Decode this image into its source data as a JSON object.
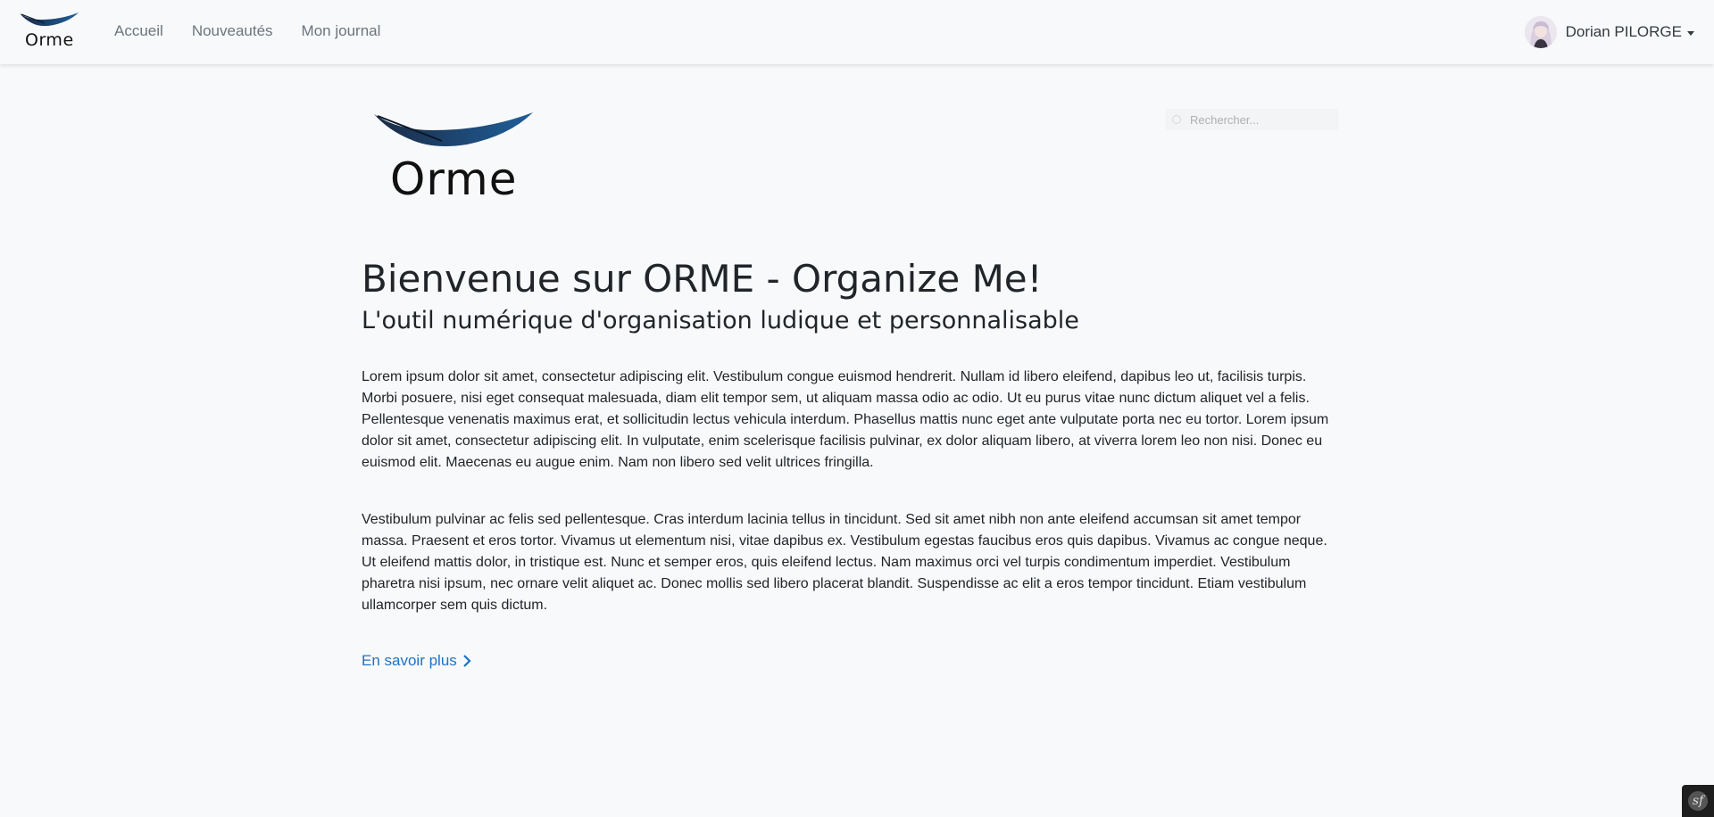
{
  "navbar": {
    "brand_text": "Orme",
    "links": [
      "Accueil",
      "Nouveautés",
      "Mon journal"
    ],
    "user": {
      "name": "Dorian PILORGE"
    }
  },
  "hero": {
    "logo_text": "Orme",
    "search_placeholder": "Rechercher...",
    "title": "Bienvenue sur ORME - Organize Me!",
    "subtitle": "L'outil numérique d'organisation ludique et personnalisable",
    "paragraphs": [
      "Lorem ipsum dolor sit amet, consectetur adipiscing elit. Vestibulum congue euismod hendrerit. Nullam id libero eleifend, dapibus leo ut, facilisis turpis. Morbi posuere, nisi eget consequat malesuada, diam elit tempor sem, ut aliquam massa odio ac odio. Ut eu purus vitae nunc dictum aliquet vel a felis. Pellentesque venenatis maximus erat, et sollicitudin lectus vehicula interdum. Phasellus mattis nunc eget ante vulputate porta nec eu tortor. Lorem ipsum dolor sit amet, consectetur adipiscing elit. In vulputate, enim scelerisque facilisis pulvinar, ex dolor aliquam libero, at viverra lorem leo non nisi. Donec eu euismod elit. Maecenas eu augue enim. Nam non libero sed velit ultrices fringilla.",
      "Vestibulum pulvinar ac felis sed pellentesque. Cras interdum lacinia tellus in tincidunt. Sed sit amet nibh non ante eleifend accumsan sit amet tempor massa. Praesent et eros tortor. Vivamus ut elementum nisi, vitae dapibus ex. Vestibulum egestas faucibus eros quis dapibus. Vivamus ac congue neque. Ut eleifend mattis dolor, in tristique est. Nunc et semper eros, quis eleifend lectus. Nam maximus orci vel turpis condimentum imperdiet. Vestibulum pharetra nisi ipsum, nec ornare velit aliquet ac. Donec mollis sed libero placerat blandit. Suspendisse ac elit a eros tempor tincidunt. Etiam vestibulum ullamcorper sem quis dictum."
    ],
    "more_link": "En savoir plus"
  },
  "colors": {
    "background": "#f8f9fa",
    "link": "#1a73c9",
    "feather_dark": "#1b2a44",
    "feather_blue": "#1f5f9a"
  },
  "icons": {
    "brand": "feather-logo-icon",
    "search": "search-icon",
    "chevron": "chevron-right-icon",
    "caret": "caret-down-icon",
    "debug": "symfony-toolbar-icon"
  }
}
